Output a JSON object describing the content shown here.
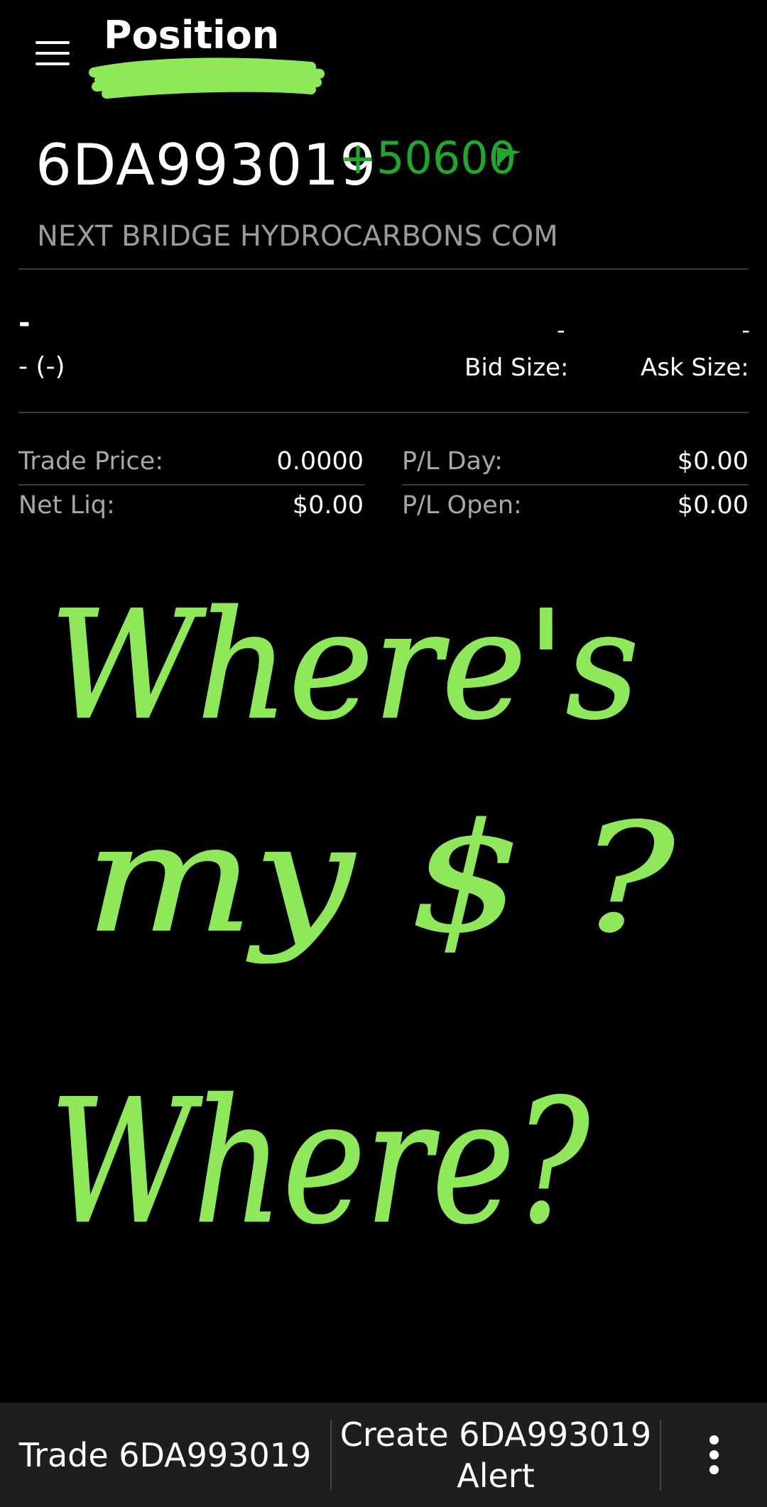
{
  "header": {
    "title": "Position"
  },
  "instrument": {
    "symbol": "6DA993019",
    "change": "+50600",
    "company": "NEXT BRIDGE HYDROCARBONS COM"
  },
  "quote": {
    "last": "-",
    "bid": "-",
    "ask": "-",
    "change_sub": "- (-)",
    "bid_size_label": "Bid Size:",
    "ask_size_label": "Ask Size:"
  },
  "stats": {
    "trade_price_label": "Trade Price:",
    "trade_price_value": "0.0000",
    "net_liq_label": "Net Liq:",
    "net_liq_value": "$0.00",
    "pl_day_label": "P/L Day:",
    "pl_day_value": "$0.00",
    "pl_open_label": "P/L Open:",
    "pl_open_value": "$0.00"
  },
  "annotation": {
    "line1": "Where's",
    "line2": "my $ ?",
    "line3": "Where?"
  },
  "bottom_bar": {
    "trade_label": "Trade 6DA993019",
    "alert_label_line1": "Create 6DA993019",
    "alert_label_line2": "Alert"
  },
  "colors": {
    "background": "#000000",
    "positive": "#1fa82c",
    "highlighter": "#8ee85a",
    "bottom_bar": "#1e1e1e"
  },
  "icons": {
    "menu": "hamburger-icon",
    "flag": "flag-icon",
    "more": "more-vertical-icon"
  }
}
